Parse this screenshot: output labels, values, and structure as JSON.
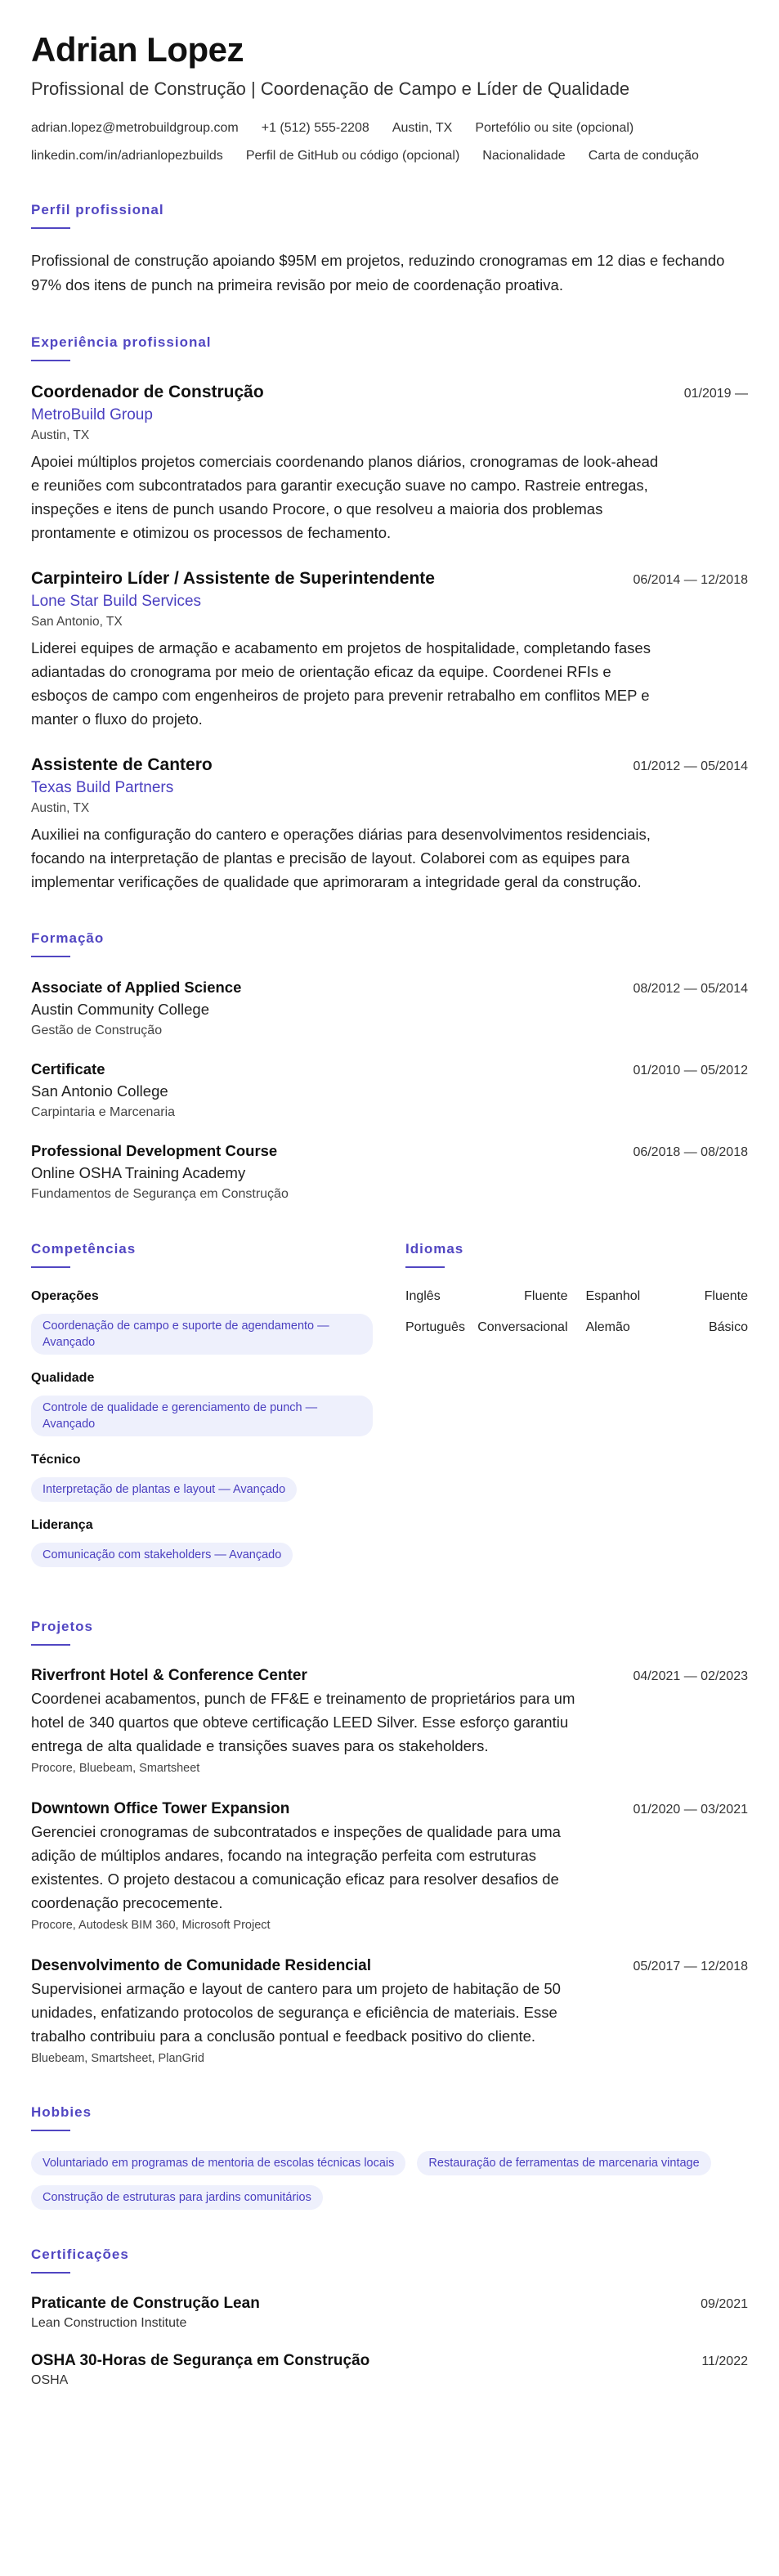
{
  "header": {
    "name": "Adrian Lopez",
    "headline": "Profissional de Construção | Coordenação de Campo e Líder de Qualidade",
    "contact": [
      "adrian.lopez@metrobuildgroup.com",
      "+1 (512) 555-2208",
      "Austin, TX",
      "Portefólio ou site (opcional)",
      "linkedin.com/in/adrianlopezbuilds",
      "Perfil de GitHub ou código (opcional)",
      "Nacionalidade",
      "Carta de condução"
    ]
  },
  "summary": {
    "title": "Perfil profissional",
    "text": "Profissional de construção apoiando $95M em projetos, reduzindo cronogramas em 12 dias e fechando 97% dos itens de punch na primeira revisão por meio de coordenação proativa."
  },
  "experience": {
    "title": "Experiência profissional",
    "items": [
      {
        "role": "Coordenador de Construção",
        "company": "MetroBuild Group",
        "location": "Austin, TX",
        "dates": "01/2019 —",
        "desc": "Apoiei múltiplos projetos comerciais coordenando planos diários, cronogramas de look-ahead e reuniões com subcontratados para garantir execução suave no campo. Rastreie entregas, inspeções e itens de punch usando Procore, o que resolveu a maioria dos problemas prontamente e otimizou os processos de fechamento."
      },
      {
        "role": "Carpinteiro Líder / Assistente de Superintendente",
        "company": "Lone Star Build Services",
        "location": "San Antonio, TX",
        "dates": "06/2014 — 12/2018",
        "desc": "Liderei equipes de armação e acabamento em projetos de hospitalidade, completando fases adiantadas do cronograma por meio de orientação eficaz da equipe. Coordenei RFIs e esboços de campo com engenheiros de projeto para prevenir retrabalho em conflitos MEP e manter o fluxo do projeto."
      },
      {
        "role": "Assistente de Cantero",
        "company": "Texas Build Partners",
        "location": "Austin, TX",
        "dates": "01/2012 — 05/2014",
        "desc": "Auxiliei na configuração do cantero e operações diárias para desenvolvimentos residenciais, focando na interpretação de plantas e precisão de layout. Colaborei com as equipes para implementar verificações de qualidade que aprimoraram a integridade geral da construção."
      }
    ]
  },
  "education": {
    "title": "Formação",
    "items": [
      {
        "degree": "Associate of Applied Science",
        "institution": "Austin Community College",
        "field": "Gestão de Construção",
        "dates": "08/2012 — 05/2014"
      },
      {
        "degree": "Certificate",
        "institution": "San Antonio College",
        "field": "Carpintaria e Marcenaria",
        "dates": "01/2010 — 05/2012"
      },
      {
        "degree": "Professional Development Course",
        "institution": "Online OSHA Training Academy",
        "field": "Fundamentos de Segurança em Construção",
        "dates": "06/2018 — 08/2018"
      }
    ]
  },
  "skills": {
    "title": "Competências",
    "groups": [
      {
        "name": "Operações",
        "chip": "Coordenação de campo e suporte de agendamento — Avançado"
      },
      {
        "name": "Qualidade",
        "chip": "Controle de qualidade e gerenciamento de punch — Avançado"
      },
      {
        "name": "Técnico",
        "chip": "Interpretação de plantas e layout — Avançado"
      },
      {
        "name": "Liderança",
        "chip": "Comunicação com stakeholders — Avançado"
      }
    ]
  },
  "languages": {
    "title": "Idiomas",
    "items": [
      {
        "name": "Inglês",
        "level": "Fluente"
      },
      {
        "name": "Espanhol",
        "level": "Fluente"
      },
      {
        "name": "Português",
        "level": "Conversacional"
      },
      {
        "name": "Alemão",
        "level": "Básico"
      }
    ]
  },
  "projects": {
    "title": "Projetos",
    "items": [
      {
        "name": "Riverfront Hotel & Conference Center",
        "dates": "04/2021 — 02/2023",
        "desc": "Coordenei acabamentos, punch de FF&E e treinamento de proprietários para um hotel de 340 quartos que obteve certificação LEED Silver. Esse esforço garantiu entrega de alta qualidade e transições suaves para os stakeholders.",
        "tools": "Procore, Bluebeam, Smartsheet"
      },
      {
        "name": "Downtown Office Tower Expansion",
        "dates": "01/2020 — 03/2021",
        "desc": "Gerenciei cronogramas de subcontratados e inspeções de qualidade para uma adição de múltiplos andares, focando na integração perfeita com estruturas existentes. O projeto destacou a comunicação eficaz para resolver desafios de coordenação precocemente.",
        "tools": "Procore, Autodesk BIM 360, Microsoft Project"
      },
      {
        "name": "Desenvolvimento de Comunidade Residencial",
        "dates": "05/2017 — 12/2018",
        "desc": "Supervisionei armação e layout de cantero para um projeto de habitação de 50 unidades, enfatizando protocolos de segurança e eficiência de materiais. Esse trabalho contribuiu para a conclusão pontual e feedback positivo do cliente.",
        "tools": "Bluebeam, Smartsheet, PlanGrid"
      }
    ]
  },
  "hobbies": {
    "title": "Hobbies",
    "items": [
      "Voluntariado em programas de mentoria de escolas técnicas locais",
      "Restauração de ferramentas de marcenaria vintage",
      "Construção de estruturas para jardins comunitários"
    ]
  },
  "certifications": {
    "title": "Certificações",
    "items": [
      {
        "name": "Praticante de Construção Lean",
        "issuer": "Lean Construction Institute",
        "date": "09/2021"
      },
      {
        "name": "OSHA 30-Horas de Segurança em Construção",
        "issuer": "OSHA",
        "date": "11/2022"
      }
    ]
  }
}
